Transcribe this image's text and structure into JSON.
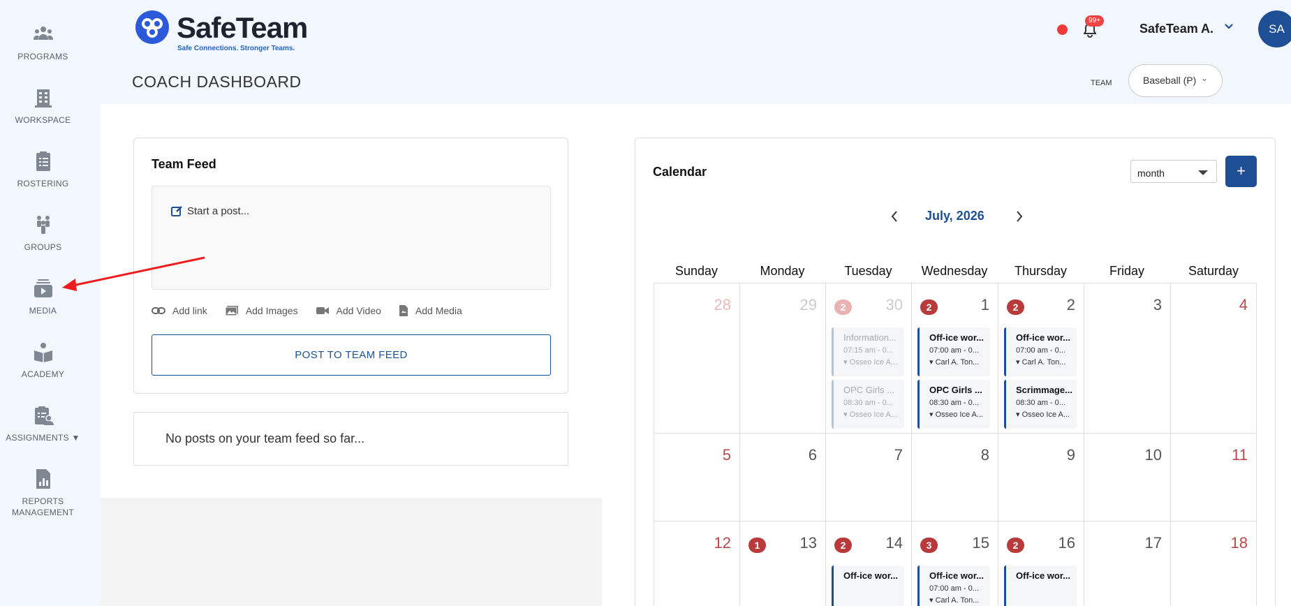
{
  "sidebar": {
    "items": [
      {
        "label": "PROGRAMS",
        "icon": "programs-icon"
      },
      {
        "label": "WORKSPACE",
        "icon": "workspace-icon"
      },
      {
        "label": "ROSTERING",
        "icon": "rostering-icon"
      },
      {
        "label": "GROUPS",
        "icon": "groups-icon"
      },
      {
        "label": "MEDIA",
        "icon": "media-icon"
      },
      {
        "label": "ACADEMY",
        "icon": "academy-icon"
      },
      {
        "label": "ASSIGNMENTS ▼",
        "icon": "assignments-icon"
      },
      {
        "label": "REPORTS MANAGEMENT",
        "icon": "reports-icon"
      }
    ]
  },
  "header": {
    "logo_text": "SafeTeam",
    "logo_tagline": "Safe Connections. Stronger Teams.",
    "page_title": "COACH DASHBOARD",
    "notification_badge": "99+",
    "user_name": "SafeTeam A.",
    "avatar_initials": "SA",
    "team_label": "TEAM",
    "team_value": "Baseball (P)"
  },
  "feed": {
    "title": "Team Feed",
    "placeholder": "Start a post...",
    "attachments": [
      "Add link",
      "Add Images",
      "Add Video",
      "Add Media"
    ],
    "post_button": "POST TO TEAM FEED",
    "empty_message": "No posts on your team feed so far..."
  },
  "calendar": {
    "title": "Calendar",
    "view": "month",
    "add_label": "+",
    "month_label": "July, 2026",
    "weekdays": [
      "Sunday",
      "Monday",
      "Tuesday",
      "Wednesday",
      "Thursday",
      "Friday",
      "Saturday"
    ],
    "weeks": [
      [
        {
          "day": "28",
          "muted": true
        },
        {
          "day": "29",
          "muted": true
        },
        {
          "day": "30",
          "muted": true,
          "count": "2",
          "events": [
            {
              "title": "Information...",
              "time": "07:15 am - 0...",
              "location": "Osseo Ice A..."
            },
            {
              "title": "OPC Girls ...",
              "time": "08:30 am - 0...",
              "location": "Osseo Ice A..."
            }
          ]
        },
        {
          "day": "1",
          "count": "2",
          "events": [
            {
              "title": "Off-ice wor...",
              "time": "07:00 am - 0...",
              "location": "Carl A. Ton..."
            },
            {
              "title": "OPC Girls ...",
              "time": "08:30 am - 0...",
              "location": "Osseo Ice A..."
            }
          ]
        },
        {
          "day": "2",
          "count": "2",
          "events": [
            {
              "title": "Off-ice wor...",
              "time": "07:00 am - 0...",
              "location": "Carl A. Ton..."
            },
            {
              "title": "Scrimmage...",
              "time": "08:30 am - 0...",
              "location": "Osseo Ice A..."
            }
          ]
        },
        {
          "day": "3"
        },
        {
          "day": "4"
        }
      ],
      [
        {
          "day": "5"
        },
        {
          "day": "6"
        },
        {
          "day": "7"
        },
        {
          "day": "8"
        },
        {
          "day": "9"
        },
        {
          "day": "10"
        },
        {
          "day": "11"
        }
      ],
      [
        {
          "day": "12"
        },
        {
          "day": "13",
          "count": "1"
        },
        {
          "day": "14",
          "count": "2",
          "events": [
            {
              "title": "Off-ice wor...",
              "time": "",
              "location": ""
            }
          ]
        },
        {
          "day": "15",
          "count": "3",
          "events": [
            {
              "title": "Off-ice wor...",
              "time": "07:00 am - 0...",
              "location": "Carl A. Ton..."
            }
          ]
        },
        {
          "day": "16",
          "count": "2",
          "events": [
            {
              "title": "Off-ice wor...",
              "time": "",
              "location": ""
            }
          ]
        },
        {
          "day": "17"
        },
        {
          "day": "18"
        }
      ]
    ]
  },
  "colors": {
    "brand": "#1e4f95",
    "weekend": "#b8484d",
    "badge": "#b83a3a",
    "sidebar_bg": "#f1f7fc"
  }
}
